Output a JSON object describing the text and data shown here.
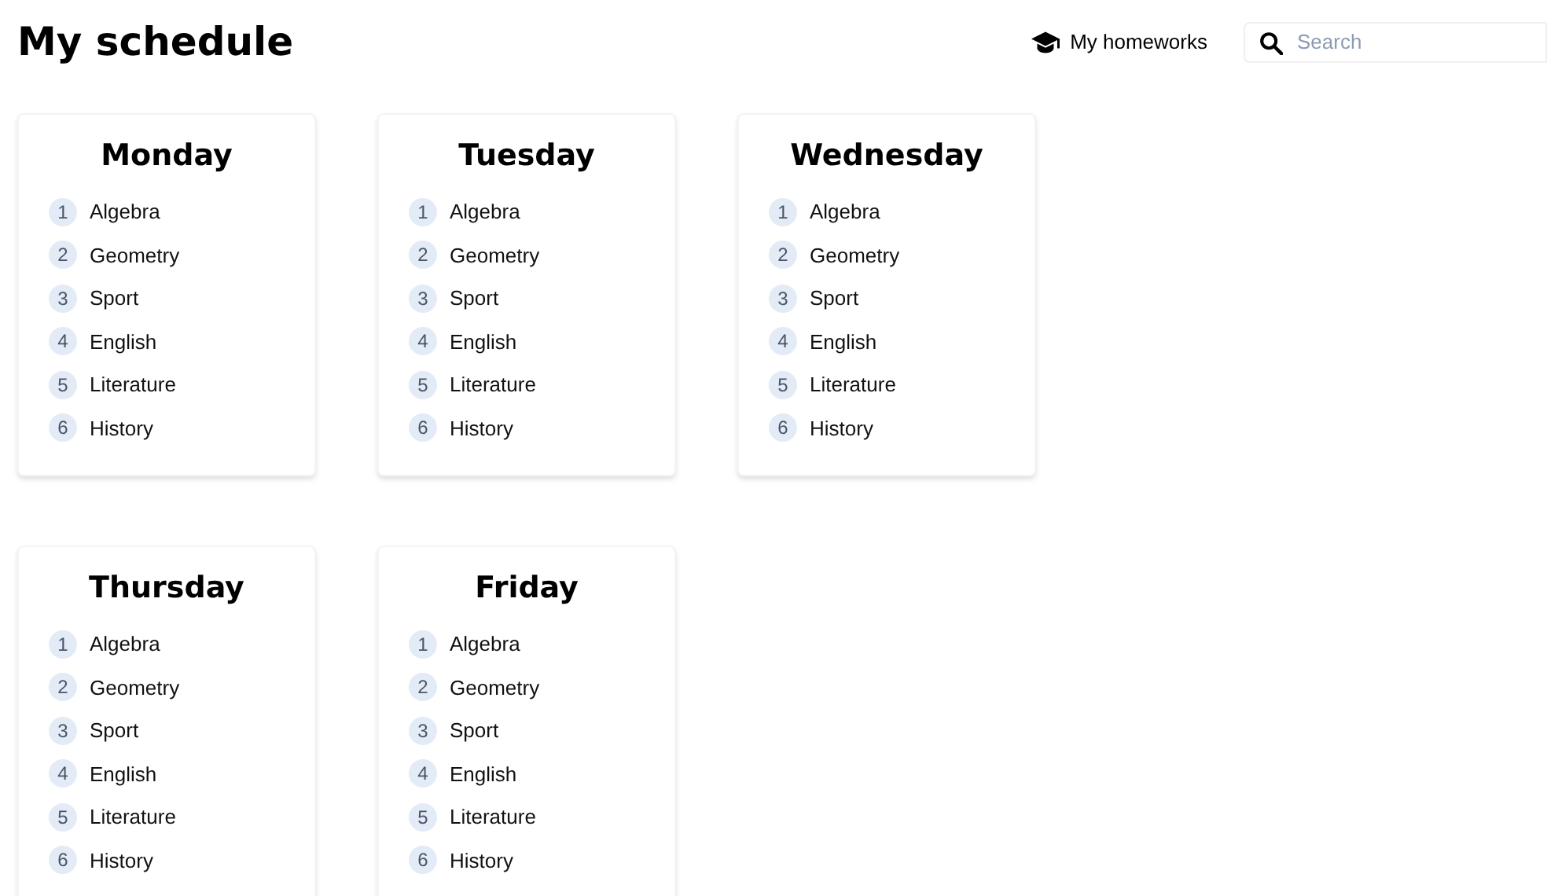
{
  "title": "My schedule",
  "homeworks_link": "My homeworks",
  "search": {
    "placeholder": "Search"
  },
  "days": [
    {
      "name": "Monday",
      "lessons": [
        {
          "number": "1",
          "subject": "Algebra"
        },
        {
          "number": "2",
          "subject": "Geometry"
        },
        {
          "number": "3",
          "subject": "Sport"
        },
        {
          "number": "4",
          "subject": "English"
        },
        {
          "number": "5",
          "subject": "Literature"
        },
        {
          "number": "6",
          "subject": "History"
        }
      ]
    },
    {
      "name": "Tuesday",
      "lessons": [
        {
          "number": "1",
          "subject": "Algebra"
        },
        {
          "number": "2",
          "subject": "Geometry"
        },
        {
          "number": "3",
          "subject": "Sport"
        },
        {
          "number": "4",
          "subject": "English"
        },
        {
          "number": "5",
          "subject": "Literature"
        },
        {
          "number": "6",
          "subject": "History"
        }
      ]
    },
    {
      "name": "Wednesday",
      "lessons": [
        {
          "number": "1",
          "subject": "Algebra"
        },
        {
          "number": "2",
          "subject": "Geometry"
        },
        {
          "number": "3",
          "subject": "Sport"
        },
        {
          "number": "4",
          "subject": "English"
        },
        {
          "number": "5",
          "subject": "Literature"
        },
        {
          "number": "6",
          "subject": "History"
        }
      ]
    },
    {
      "name": "Thursday",
      "lessons": [
        {
          "number": "1",
          "subject": "Algebra"
        },
        {
          "number": "2",
          "subject": "Geometry"
        },
        {
          "number": "3",
          "subject": "Sport"
        },
        {
          "number": "4",
          "subject": "English"
        },
        {
          "number": "5",
          "subject": "Literature"
        },
        {
          "number": "6",
          "subject": "History"
        }
      ]
    },
    {
      "name": "Friday",
      "lessons": [
        {
          "number": "1",
          "subject": "Algebra"
        },
        {
          "number": "2",
          "subject": "Geometry"
        },
        {
          "number": "3",
          "subject": "Sport"
        },
        {
          "number": "4",
          "subject": "English"
        },
        {
          "number": "5",
          "subject": "Literature"
        },
        {
          "number": "6",
          "subject": "History"
        }
      ]
    }
  ]
}
